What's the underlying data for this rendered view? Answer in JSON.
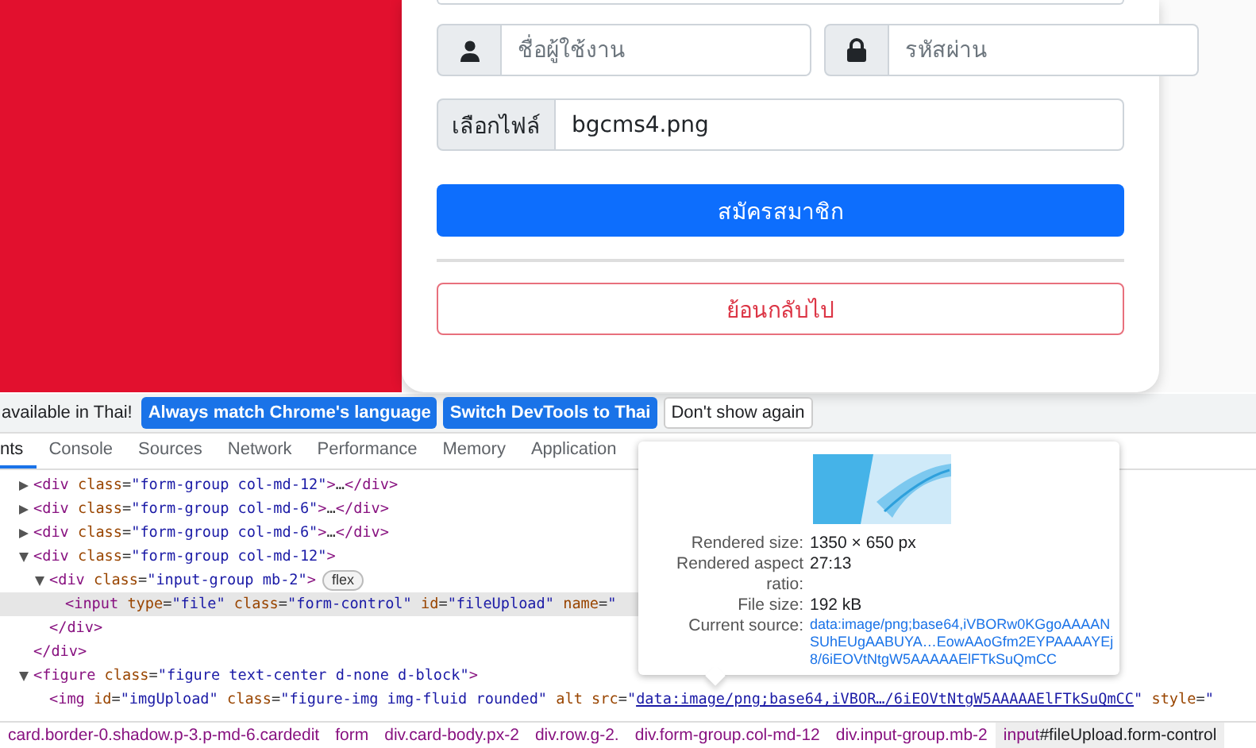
{
  "form": {
    "username": {
      "placeholder": "ชื่อผู้ใช้งาน"
    },
    "password": {
      "placeholder": "รหัสผ่าน"
    },
    "file": {
      "button": "เลือกไฟล์",
      "value": "bgcms4.png"
    },
    "submit": "สมัครสมาชิก",
    "back": "ย้อนกลับไป"
  },
  "infobar": {
    "message": "available in Thai!",
    "buttons": [
      {
        "label": "Always match Chrome's language",
        "kind": "primary"
      },
      {
        "label": "Switch DevTools to Thai",
        "kind": "primary"
      },
      {
        "label": "Don't show again",
        "kind": "plain"
      }
    ]
  },
  "tabs": [
    {
      "label": "nts",
      "selected": true
    },
    {
      "label": "Console",
      "selected": false
    },
    {
      "label": "Sources",
      "selected": false
    },
    {
      "label": "Network",
      "selected": false
    },
    {
      "label": "Performance",
      "selected": false
    },
    {
      "label": "Memory",
      "selected": false
    },
    {
      "label": "Application",
      "selected": false
    }
  ],
  "dom_tree": [
    {
      "kind": "element",
      "expanded": false,
      "selected": false,
      "open": "<div class=\"form-group col-md-12\">…</div>"
    },
    {
      "kind": "element",
      "expanded": false,
      "selected": false,
      "open": "<div class=\"form-group col-md-6\">…</div>"
    },
    {
      "kind": "element",
      "expanded": false,
      "selected": false,
      "open": "<div class=\"form-group col-md-6\">…</div>"
    },
    {
      "kind": "element",
      "expanded": true,
      "selected": false,
      "open": "<div class=\"form-group col-md-12\">",
      "close": "</div>",
      "children": [
        {
          "kind": "element",
          "expanded": true,
          "selected": false,
          "open": "<div class=\"input-group mb-2\">",
          "badge": "flex",
          "close": "</div>",
          "children": [
            {
              "kind": "leaf",
              "selected": true,
              "open": "<input type=\"file\" class=\"form-control\" id=\"fileUpload\" name=\""
            }
          ]
        }
      ]
    },
    {
      "kind": "element",
      "expanded": true,
      "selected": false,
      "open": "<figure class=\"figure text-center d-none d-block\">",
      "children": [
        {
          "kind": "leaf-link",
          "selected": false,
          "parts": [
            {
              "kind": "code",
              "text": "<img id=\"imgUpload\" class=\"figure-img img-fluid rounded\" alt src=\""
            },
            {
              "kind": "link",
              "text": "data:image/png;base64,iVBOR…/6iEOVtNtgW5AAAAAElFTkSuQmCC"
            },
            {
              "kind": "code",
              "text": "\" style=\""
            }
          ]
        }
      ]
    }
  ],
  "breadcrumbs": [
    {
      "label": "card.border-0.shadow.p-3.p-md-6.cardedit",
      "selected": false
    },
    {
      "label": "form",
      "selected": false
    },
    {
      "label": "div.card-body.px-2",
      "selected": false
    },
    {
      "label": "div.row.g-2.",
      "selected": false
    },
    {
      "label": "div.form-group.col-md-12",
      "selected": false
    },
    {
      "label": "div.input-group.mb-2",
      "selected": false
    },
    {
      "label": "input#fileUpload.form-control",
      "selected": true
    }
  ],
  "tooltip": {
    "rows": [
      {
        "label": "Rendered size:",
        "value": "1350 × 650 px",
        "kind": "text"
      },
      {
        "label": "Rendered aspect ratio:",
        "value": "27:13",
        "kind": "text"
      },
      {
        "label": "File size:",
        "value": "192 kB",
        "kind": "text"
      },
      {
        "label": "Current source:",
        "value": "data:image/png;base64,iVBORw0KGgoAAAANSUhEUgAABUYA…EowAAoGfm2EYPAAAAYEj8/6iEOVtNtgW5AAAAAElFTkSuQmCC",
        "kind": "link"
      }
    ]
  }
}
